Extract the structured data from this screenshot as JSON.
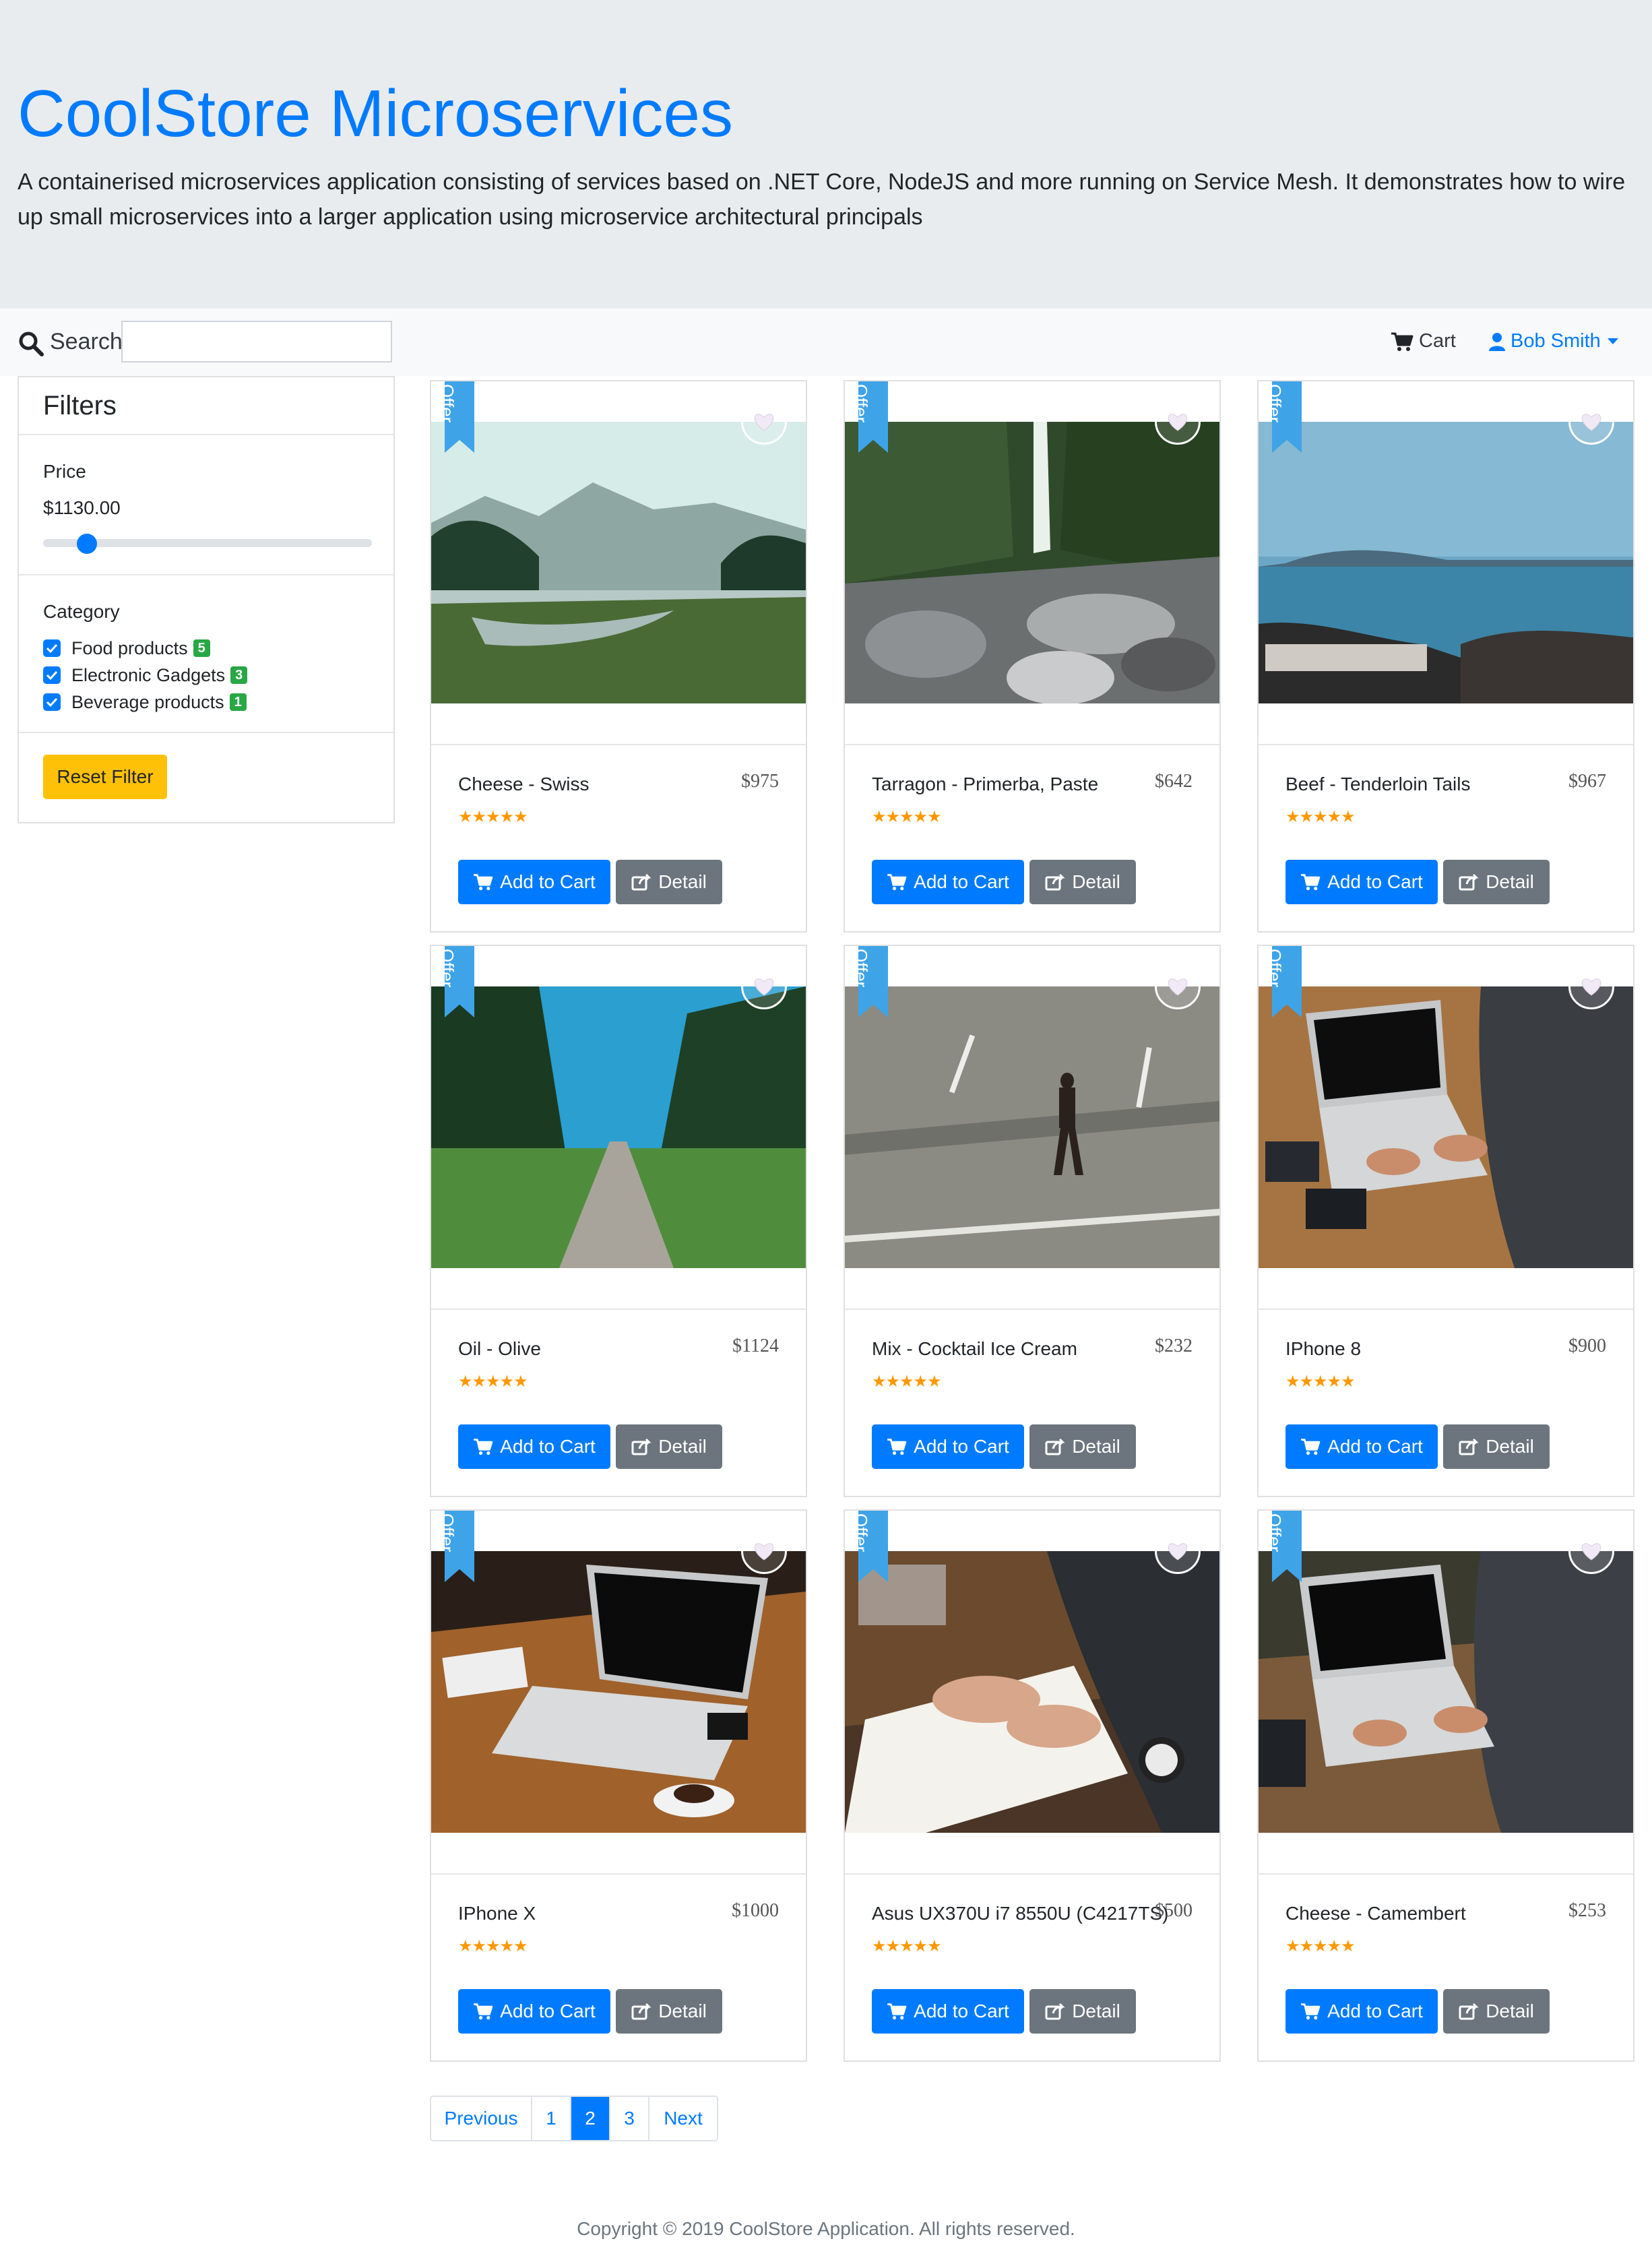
{
  "jumbotron": {
    "title": "CoolStore Microservices",
    "lead": "A containerised microservices application consisting of services based on .NET Core, NodeJS and more running on Service Mesh. It demonstrates how to wire up small microservices into a larger application using microservice architectural principals"
  },
  "nav": {
    "search_label": "Search",
    "search_value": "",
    "cart_label": "Cart",
    "user_label": "Bob Smith"
  },
  "filters": {
    "title": "Filters",
    "price_label": "Price",
    "price_value": "$1130.00",
    "category_label": "Category",
    "categories": [
      {
        "label": "Food products",
        "count": "5",
        "checked": true
      },
      {
        "label": "Electronic Gadgets",
        "count": "3",
        "checked": true
      },
      {
        "label": "Beverage products",
        "count": "1",
        "checked": true
      }
    ],
    "reset_label": "Reset Filter"
  },
  "products": [
    {
      "name": "Cheese - Swiss",
      "price": "$975",
      "offer": "Offer",
      "rating": "★★★★★",
      "image": "lake-landscape"
    },
    {
      "name": "Tarragon - Primerba, Paste",
      "price": "$642",
      "offer": "Offer",
      "rating": "★★★★★",
      "image": "waterfall-rocks"
    },
    {
      "name": "Beef - Tenderloin Tails",
      "price": "$967",
      "offer": "Offer",
      "rating": "★★★★★",
      "image": "sea-shore"
    },
    {
      "name": "Oil - Olive",
      "price": "$1124",
      "offer": "Offer",
      "rating": "★★★★★",
      "image": "forest-path"
    },
    {
      "name": "Mix - Cocktail Ice Cream",
      "price": "$232",
      "offer": "Offer",
      "rating": "★★★★★",
      "image": "man-on-road"
    },
    {
      "name": "IPhone 8",
      "price": "$900",
      "offer": "Offer",
      "rating": "★★★★★",
      "image": "laptop-typing"
    },
    {
      "name": "IPhone X",
      "price": "$1000",
      "offer": "Offer",
      "rating": "★★★★★",
      "image": "laptop-desk"
    },
    {
      "name": "Asus UX370U i7 8550U (C4217TS)",
      "price": "$500",
      "offer": "Offer",
      "rating": "★★★★★",
      "image": "writing-notebook"
    },
    {
      "name": "Cheese - Camembert",
      "price": "$253",
      "offer": "Offer",
      "rating": "★★★★★",
      "image": "laptop-typing-2"
    }
  ],
  "buttons": {
    "add_to_cart": "Add to Cart",
    "detail": "Detail"
  },
  "pagination": {
    "previous": "Previous",
    "pages": [
      "1",
      "2",
      "3"
    ],
    "active_page": "2",
    "next": "Next"
  },
  "footer": "Copyright © 2019 CoolStore Application. All rights reserved.",
  "colors": {
    "primary": "#007bff",
    "secondary": "#6c757d",
    "warning": "#ffc107",
    "success": "#28a745",
    "ribbon": "#3fa3e8",
    "star": "#ff9800",
    "jumbotron_bg": "#e9ecef"
  }
}
